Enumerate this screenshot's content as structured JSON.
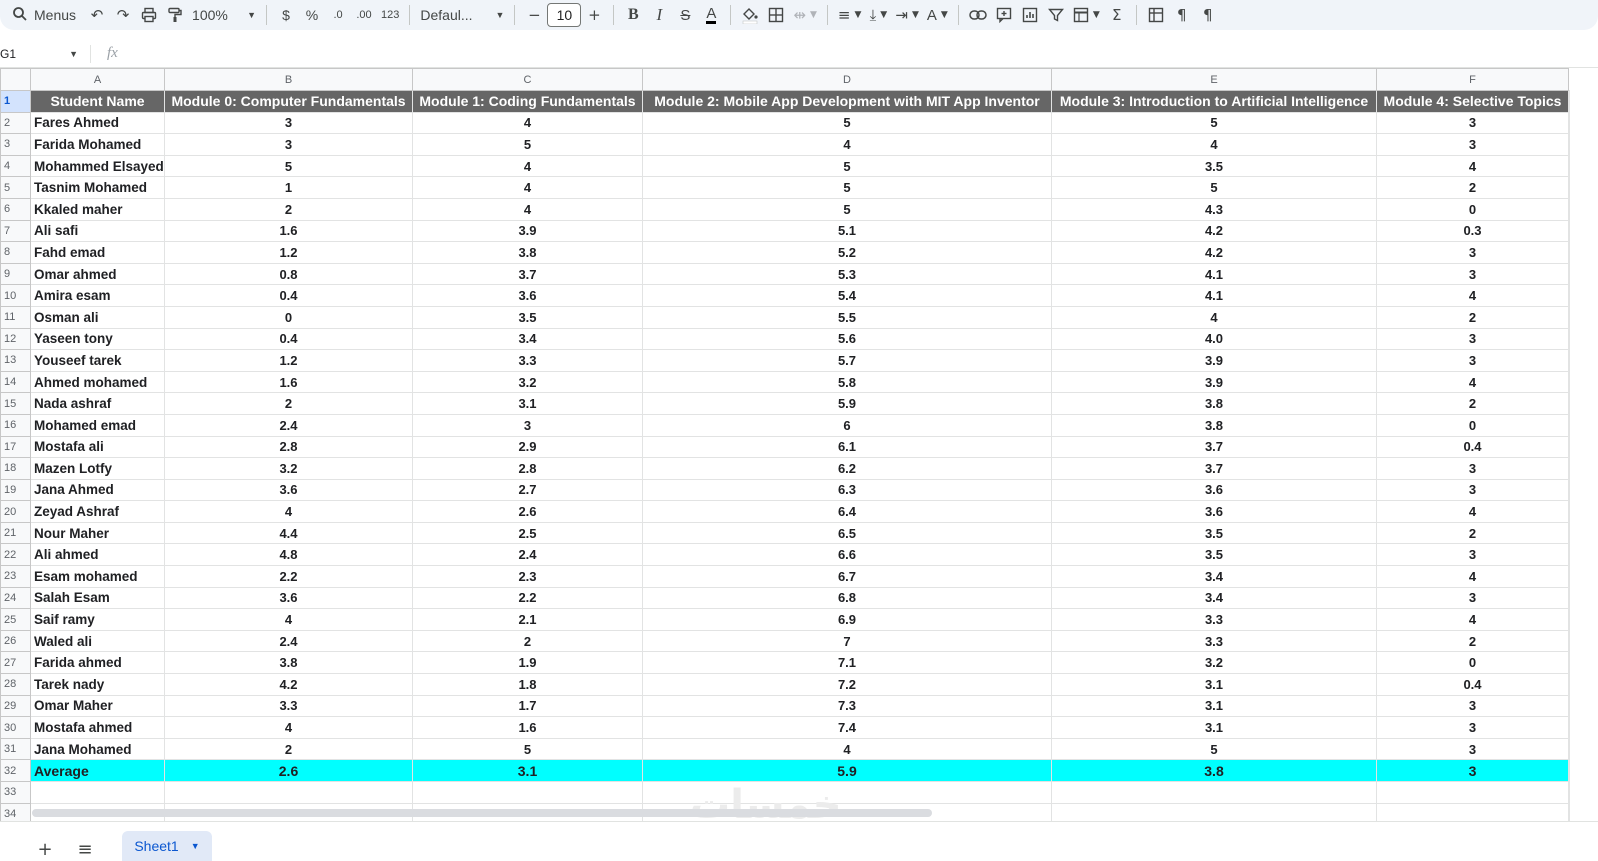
{
  "toolbar": {
    "menus_label": "Menus",
    "zoom": "100%",
    "currency": "$",
    "percent": "%",
    "dec_decrease": ".0",
    "dec_increase": ".00",
    "number_format": "123",
    "font": "Defaul...",
    "font_size": "10"
  },
  "formula_bar": {
    "cell_ref": "G1",
    "fx": "fx",
    "value": ""
  },
  "columns": [
    "A",
    "B",
    "C",
    "D",
    "E",
    "F"
  ],
  "headers": [
    "Student Name",
    "Module 0: Computer Fundamentals",
    "Module 1: Coding Fundamentals",
    "Module 2: Mobile App Development with MIT App Inventor",
    "Module 3: Introduction to Artificial Intelligence",
    "Module 4: Selective Topics"
  ],
  "rows": [
    [
      "Fares Ahmed",
      "3",
      "4",
      "5",
      "5",
      "3"
    ],
    [
      "Farida Mohamed",
      "3",
      "5",
      "4",
      "4",
      "3"
    ],
    [
      "Mohammed Elsayed",
      "5",
      "4",
      "5",
      "3.5",
      "4"
    ],
    [
      "Tasnim Mohamed",
      "1",
      "4",
      "5",
      "5",
      "2"
    ],
    [
      "Kkaled maher",
      "2",
      "4",
      "5",
      "4.3",
      "0"
    ],
    [
      "Ali safi",
      "1.6",
      "3.9",
      "5.1",
      "4.2",
      "0.3"
    ],
    [
      "Fahd emad",
      "1.2",
      "3.8",
      "5.2",
      "4.2",
      "3"
    ],
    [
      "Omar ahmed",
      "0.8",
      "3.7",
      "5.3",
      "4.1",
      "3"
    ],
    [
      "Amira esam",
      "0.4",
      "3.6",
      "5.4",
      "4.1",
      "4"
    ],
    [
      "Osman ali",
      "0",
      "3.5",
      "5.5",
      "4",
      "2"
    ],
    [
      "Yaseen tony",
      "0.4",
      "3.4",
      "5.6",
      "4.0",
      "3"
    ],
    [
      "Youseef tarek",
      "1.2",
      "3.3",
      "5.7",
      "3.9",
      "3"
    ],
    [
      "Ahmed mohamed",
      "1.6",
      "3.2",
      "5.8",
      "3.9",
      "4"
    ],
    [
      "Nada ashraf",
      "2",
      "3.1",
      "5.9",
      "3.8",
      "2"
    ],
    [
      "Mohamed emad",
      "2.4",
      "3",
      "6",
      "3.8",
      "0"
    ],
    [
      "Mostafa ali",
      "2.8",
      "2.9",
      "6.1",
      "3.7",
      "0.4"
    ],
    [
      "Mazen Lotfy",
      "3.2",
      "2.8",
      "6.2",
      "3.7",
      "3"
    ],
    [
      "Jana Ahmed",
      "3.6",
      "2.7",
      "6.3",
      "3.6",
      "3"
    ],
    [
      "Zeyad Ashraf",
      "4",
      "2.6",
      "6.4",
      "3.6",
      "4"
    ],
    [
      "Nour Maher",
      "4.4",
      "2.5",
      "6.5",
      "3.5",
      "2"
    ],
    [
      "Ali ahmed",
      "4.8",
      "2.4",
      "6.6",
      "3.5",
      "3"
    ],
    [
      "Esam mohamed",
      "2.2",
      "2.3",
      "6.7",
      "3.4",
      "4"
    ],
    [
      "Salah Esam",
      "3.6",
      "2.2",
      "6.8",
      "3.4",
      "3"
    ],
    [
      "Saif ramy",
      "4",
      "2.1",
      "6.9",
      "3.3",
      "4"
    ],
    [
      "Waled ali",
      "2.4",
      "2",
      "7",
      "3.3",
      "2"
    ],
    [
      "Farida ahmed",
      "3.8",
      "1.9",
      "7.1",
      "3.2",
      "0"
    ],
    [
      "Tarek nady",
      "4.2",
      "1.8",
      "7.2",
      "3.1",
      "0.4"
    ],
    [
      "Omar Maher",
      "3.3",
      "1.7",
      "7.3",
      "3.1",
      "3"
    ],
    [
      "Mostafa ahmed",
      "4",
      "1.6",
      "7.4",
      "3.1",
      "3"
    ],
    [
      "Jana Mohamed",
      "2",
      "5",
      "4",
      "5",
      "3"
    ]
  ],
  "average_row": [
    "Average",
    "2.6",
    "3.1",
    "5.9",
    "3.8",
    "3"
  ],
  "average_highlight_color": "#00ffff",
  "header_fill_color": "#666666",
  "sheet_tabs": [
    "Sheet1"
  ],
  "watermark_text": "خمسات",
  "icons": [
    "search-icon",
    "undo-icon",
    "redo-icon",
    "print-icon",
    "paint-format-icon",
    "bold-icon",
    "italic-icon",
    "strikethrough-icon",
    "text-color-icon",
    "fill-color-icon",
    "borders-icon",
    "merge-icon",
    "align-icon",
    "valign-icon",
    "wrap-icon",
    "rotate-icon",
    "link-icon",
    "comment-icon",
    "chart-icon",
    "filter-icon",
    "table-view-icon",
    "functions-icon",
    "freeze-icon",
    "ltr-icon",
    "rtl-icon"
  ]
}
